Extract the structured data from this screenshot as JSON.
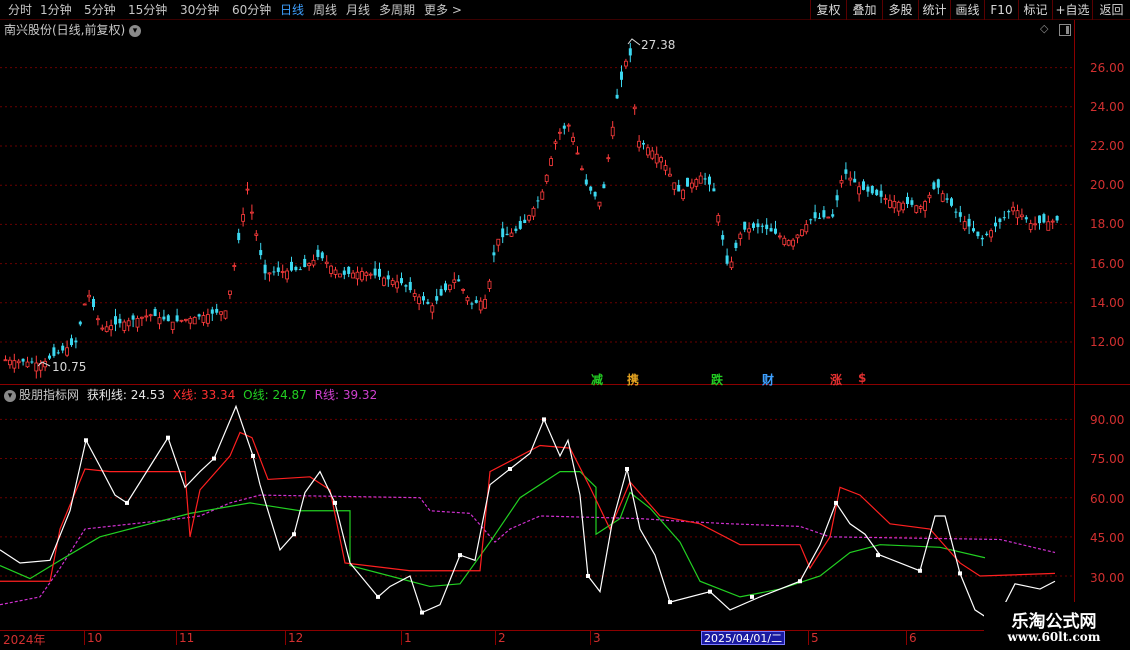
{
  "toolbar": {
    "periods": [
      "分时",
      "1分钟",
      "5分钟",
      "15分钟",
      "30分钟",
      "60分钟",
      "日线",
      "周线",
      "月线",
      "多周期",
      "更多"
    ],
    "active_period": "日线",
    "buttons": [
      "复权",
      "叠加",
      "多股",
      "统计",
      "画线",
      "F10",
      "标记",
      "+自选",
      "返回"
    ]
  },
  "main_panel": {
    "title": "南兴股份(日线,前复权)",
    "y_ticks": [
      "26.00",
      "24.00",
      "22.00",
      "20.00",
      "18.00",
      "16.00",
      "14.00",
      "12.00"
    ],
    "high_label": "27.38",
    "low_label": "10.75",
    "signals": [
      {
        "text": "减",
        "color": "#22cc22"
      },
      {
        "text": "携",
        "color": "#e0a020"
      },
      {
        "text": "跌",
        "color": "#22cc22"
      },
      {
        "text": "财",
        "color": "#3ea0ff"
      },
      {
        "text": "涨",
        "color": "#e03030"
      },
      {
        "text": "$",
        "color": "#e03030"
      }
    ]
  },
  "indicator_panel": {
    "name": "股朋指标网",
    "profit_label": "获利线: 24.53",
    "x_label": "X线: 33.34",
    "o_label": "O线: 24.87",
    "r_label": "R线: 39.32",
    "y_ticks": [
      "90.00",
      "75.00",
      "60.00",
      "45.00",
      "30.00"
    ]
  },
  "x_axis": {
    "labels": [
      "2024年",
      "10",
      "11",
      "12",
      "1",
      "2",
      "3",
      "4",
      "5",
      "6"
    ],
    "cursor_date": "2025/04/01/二"
  },
  "watermark": {
    "title": "乐淘公式网",
    "url": "www.60lt.com"
  },
  "colors": {
    "up": "#ff3c3c",
    "down": "#3cd8f0",
    "grid": "#8b0000",
    "profit_line": "#ffffff",
    "x_line": "#ff2020",
    "o_line": "#22d022",
    "r_line": "#d030d0"
  },
  "chart_data": {
    "type": "candlestick",
    "price_range": [
      10.75,
      27.38
    ],
    "indicator_range": [
      20,
      100
    ],
    "series": [
      {
        "name": "获利线",
        "latest": 24.53
      },
      {
        "name": "X线",
        "latest": 33.34
      },
      {
        "name": "O线",
        "latest": 24.87
      },
      {
        "name": "R线",
        "latest": 39.32
      }
    ]
  }
}
